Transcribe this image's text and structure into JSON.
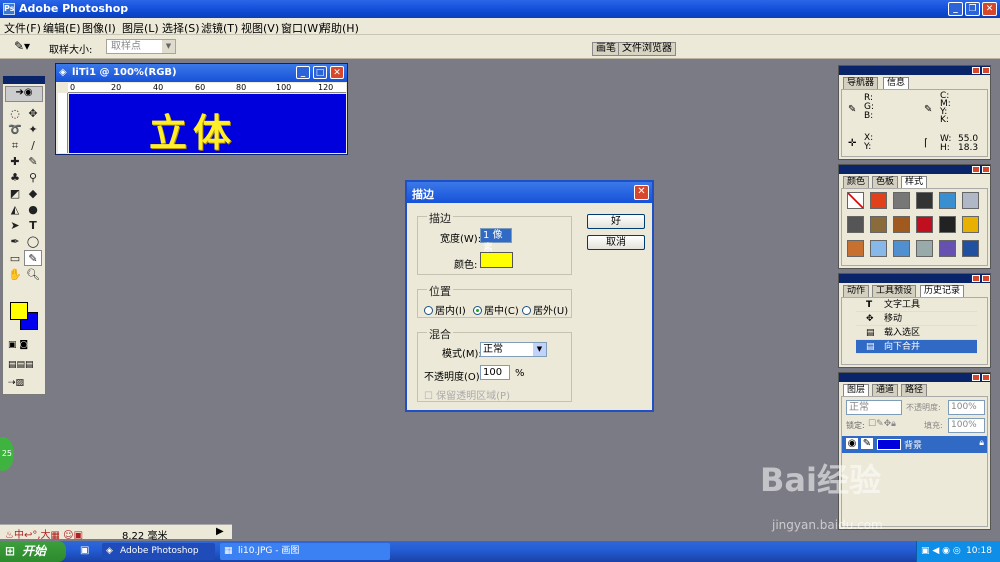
{
  "app": {
    "title": "Adobe Photoshop"
  },
  "menu": [
    "文件(F)",
    "编辑(E)",
    "图像(I)",
    "图层(L)",
    "选择(S)",
    "滤镜(T)",
    "视图(V)",
    "窗口(W)",
    "帮助(H)"
  ],
  "options": {
    "sample_size_label": "取样大小:",
    "sample_size_value": "取样点"
  },
  "well_tabs": [
    "画笔",
    "文件浏览器"
  ],
  "document": {
    "title": "liTi1 @ 100%(RGB)",
    "canvas_text": "立体",
    "ruler_marks": [
      "0",
      "20",
      "40",
      "60",
      "80",
      "100",
      "120"
    ]
  },
  "dialog": {
    "title": "描边",
    "stroke_group": "描边",
    "width_label": "宽度(W):",
    "width_value": "1 像素",
    "color_label": "颜色:",
    "stroke_color": "#ffff00",
    "position_group": "位置",
    "pos_inside": "居内(I)",
    "pos_center": "居中(C)",
    "pos_outside": "居外(U)",
    "blend_group": "混合",
    "mode_label": "模式(M):",
    "mode_value": "正常",
    "opacity_label": "不透明度(O):",
    "opacity_value": "100",
    "opacity_unit": "%",
    "preserve_label": "保留透明区域(P)",
    "ok": "好",
    "cancel": "取消"
  },
  "nav_panel": {
    "tabs": [
      "导航器",
      "信息"
    ],
    "rgb": "R:\nG:\nB:",
    "cmyk": "C:\nM:\nY:\nK:",
    "xy": "X:\nY:",
    "w_label": "W:",
    "w_value": "55.0",
    "h_label": "H:",
    "h_value": "18.3"
  },
  "color_panel": {
    "tabs": [
      "颜色",
      "色板",
      "样式"
    ]
  },
  "history_panel": {
    "tabs": [
      "动作",
      "工具预设",
      "历史记录"
    ],
    "items": [
      "文字工具",
      "移动",
      "载入选区",
      "向下合并"
    ]
  },
  "layers_panel": {
    "tabs": [
      "图层",
      "通道",
      "路径"
    ],
    "mode": "正常",
    "opacity_label": "不透明度:",
    "opacity_value": "100%",
    "lock_label": "锁定:",
    "fill_label": "填充:",
    "fill_value": "100%",
    "layer_name": "背景"
  },
  "status": {
    "value": "8.22 毫米"
  },
  "taskbar": {
    "start": "开始",
    "tasks": [
      "Adobe Photoshop",
      "li10.JPG - 画图"
    ],
    "clock": "10:18"
  },
  "watermark": {
    "brand": "Bai经验",
    "url": "jingyan.baidu.com"
  },
  "badge": "25"
}
